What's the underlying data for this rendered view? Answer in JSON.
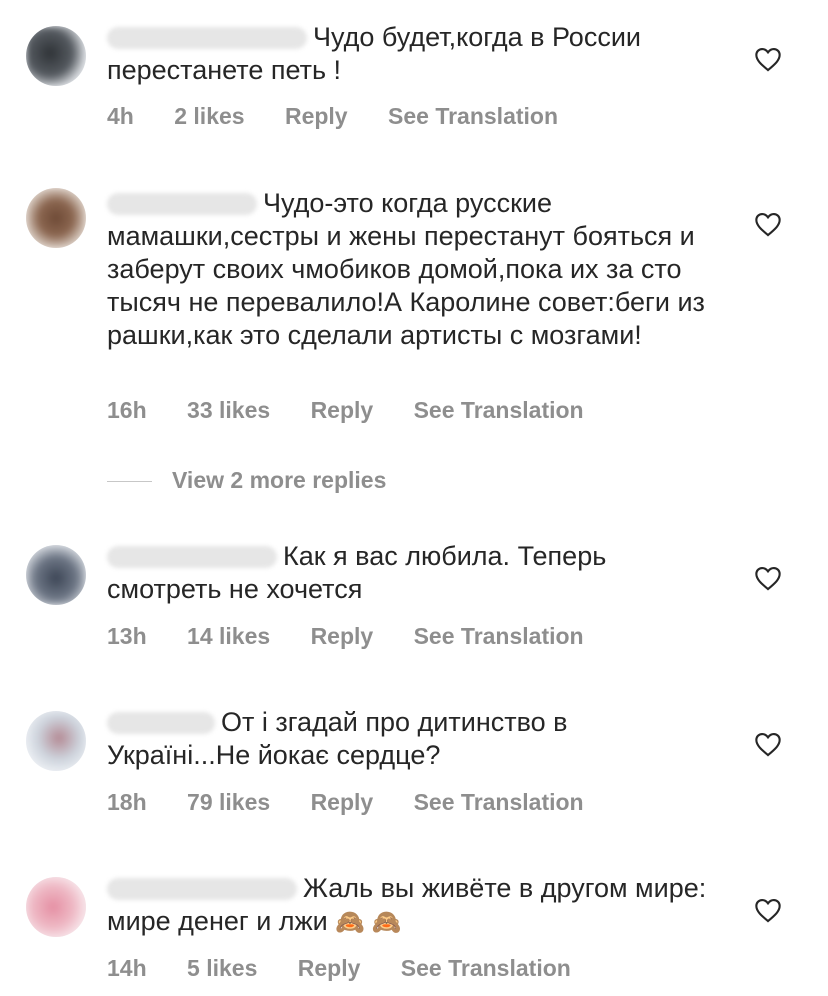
{
  "comments": [
    {
      "text": "Чудо будет,когда в России перестанете петь !",
      "time": "4h",
      "likes": "2 likes",
      "reply": "Reply",
      "translate": "See Translation",
      "avatar_color": "#3b3f45"
    },
    {
      "text": "Чудо-это когда русские мамашки,сестры и жены перестанут бояться и заберут своих чмобиков домой,пока их за сто тысяч не перевалило!А Каролине совет:беги из рашки,как это сделали артисты с мозгами!",
      "time": "16h",
      "likes": "33 likes",
      "reply": "Reply",
      "translate": "See Translation",
      "avatar_color": "#7a5a44"
    },
    {
      "text": "Как я вас любила. Теперь смотреть не хочется",
      "time": "13h",
      "likes": "14 likes",
      "reply": "Reply",
      "translate": "See Translation",
      "avatar_color": "#5a6270"
    },
    {
      "text": "От і згадай про дитинство в Україні...Не йокає сердце?",
      "time": "18h",
      "likes": "79 likes",
      "reply": "Reply",
      "translate": "See Translation",
      "avatar_color": "#cfd6e0"
    },
    {
      "text": "Жаль вы  живёте в другом мире: мире денег и лжи",
      "emoji": "🙈 🙈",
      "time": "14h",
      "likes": "5 likes",
      "reply": "Reply",
      "translate": "See Translation",
      "avatar_color": "#e7a4b4"
    }
  ],
  "view_more": "View 2 more replies",
  "colors": {
    "text": "#262626",
    "secondary": "#8e8e8e"
  }
}
